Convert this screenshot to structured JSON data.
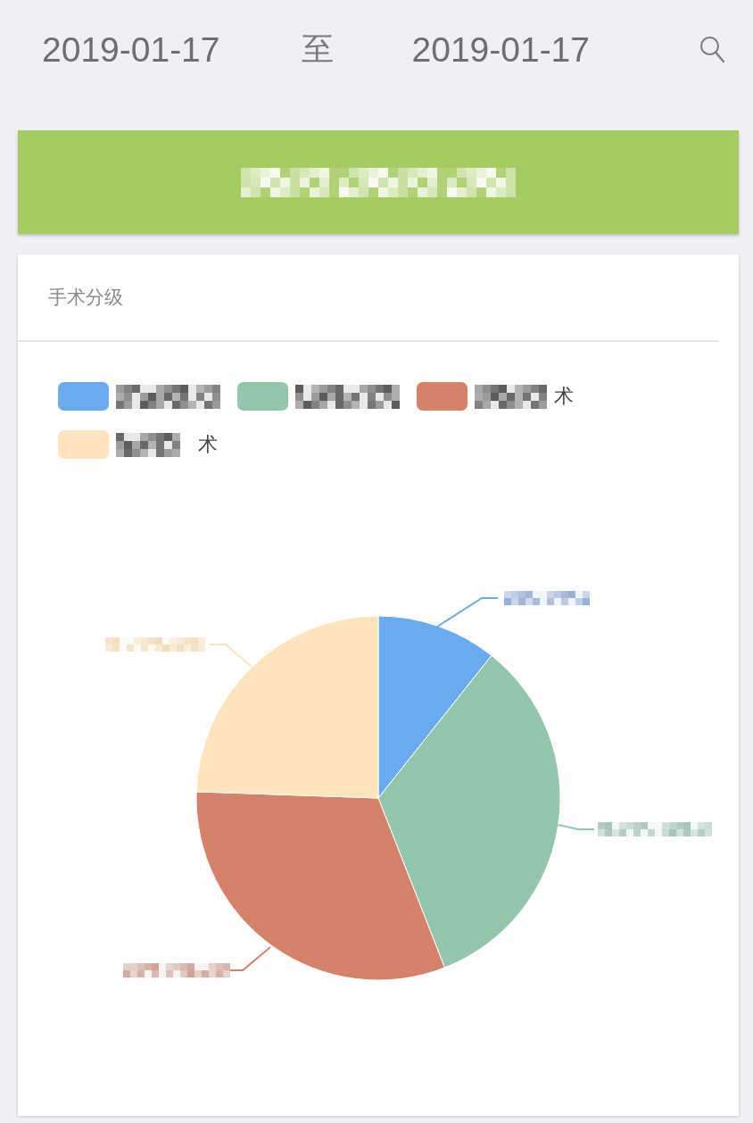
{
  "date_range": {
    "start": "2019-01-17",
    "separator": "至",
    "end": "2019-01-17"
  },
  "summary_banner": {
    "text_pixelated": true
  },
  "chart_card": {
    "title": "手术分级",
    "legend": [
      {
        "color": "#6aabed",
        "label_pixelated": true
      },
      {
        "color": "#94c6ae",
        "label_pixelated": true
      },
      {
        "color": "#d4826a",
        "label_pixelated": true,
        "visible_text": "术"
      },
      {
        "color": "#fde4bc",
        "label_pixelated": true,
        "visible_text": "术"
      }
    ],
    "pie": {
      "slice_labels_pixelated": true
    }
  }
}
